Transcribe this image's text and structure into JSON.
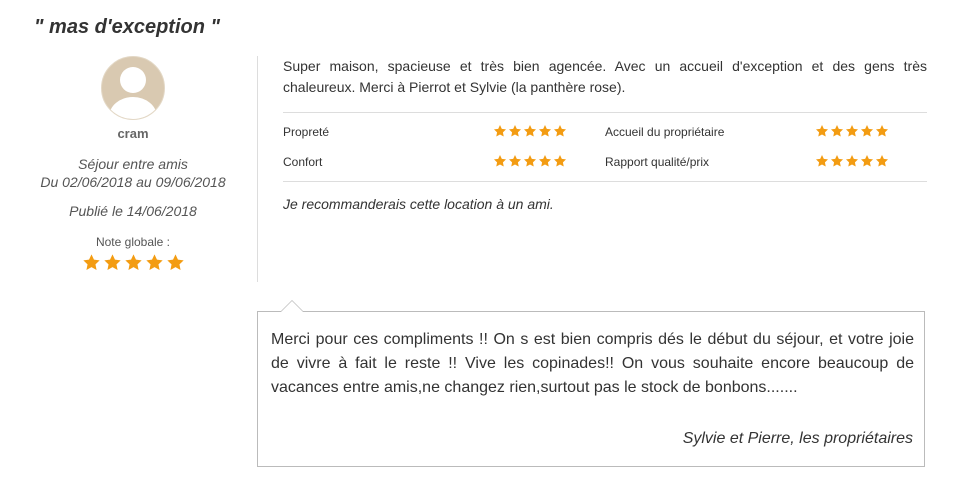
{
  "review": {
    "title": "\" mas d'exception \"",
    "author": {
      "name": "cram",
      "trip_type": "Séjour entre amis",
      "dates": "Du 02/06/2018 au 09/06/2018",
      "published": "Publié le 14/06/2018",
      "overall_label": "Note globale :",
      "overall_stars": 5
    },
    "text": "Super maison, spacieuse et très bien agencée. Avec un accueil d'exception et des gens très chaleureux. Merci à Pierrot et Sylvie (la panthère rose).",
    "ratings": [
      {
        "label": "Propreté",
        "stars": 5
      },
      {
        "label": "Accueil du propriétaire",
        "stars": 5
      },
      {
        "label": "Confort",
        "stars": 5
      },
      {
        "label": "Rapport qualité/prix",
        "stars": 5
      }
    ],
    "recommendation": "Je recommanderais cette location à un ami."
  },
  "reply": {
    "text": "Merci pour ces compliments !! On s est bien compris dés le début du séjour, et votre joie de vivre à fait le reste !! Vive les copinades!! On vous souhaite encore beaucoup de vacances entre amis,ne changez rien,surtout pas le stock de bonbons.......",
    "signature": "Sylvie et Pierre, les propriétaires"
  },
  "colors": {
    "star": "#f39c12",
    "text": "#333333",
    "border": "#bbbbbb"
  }
}
